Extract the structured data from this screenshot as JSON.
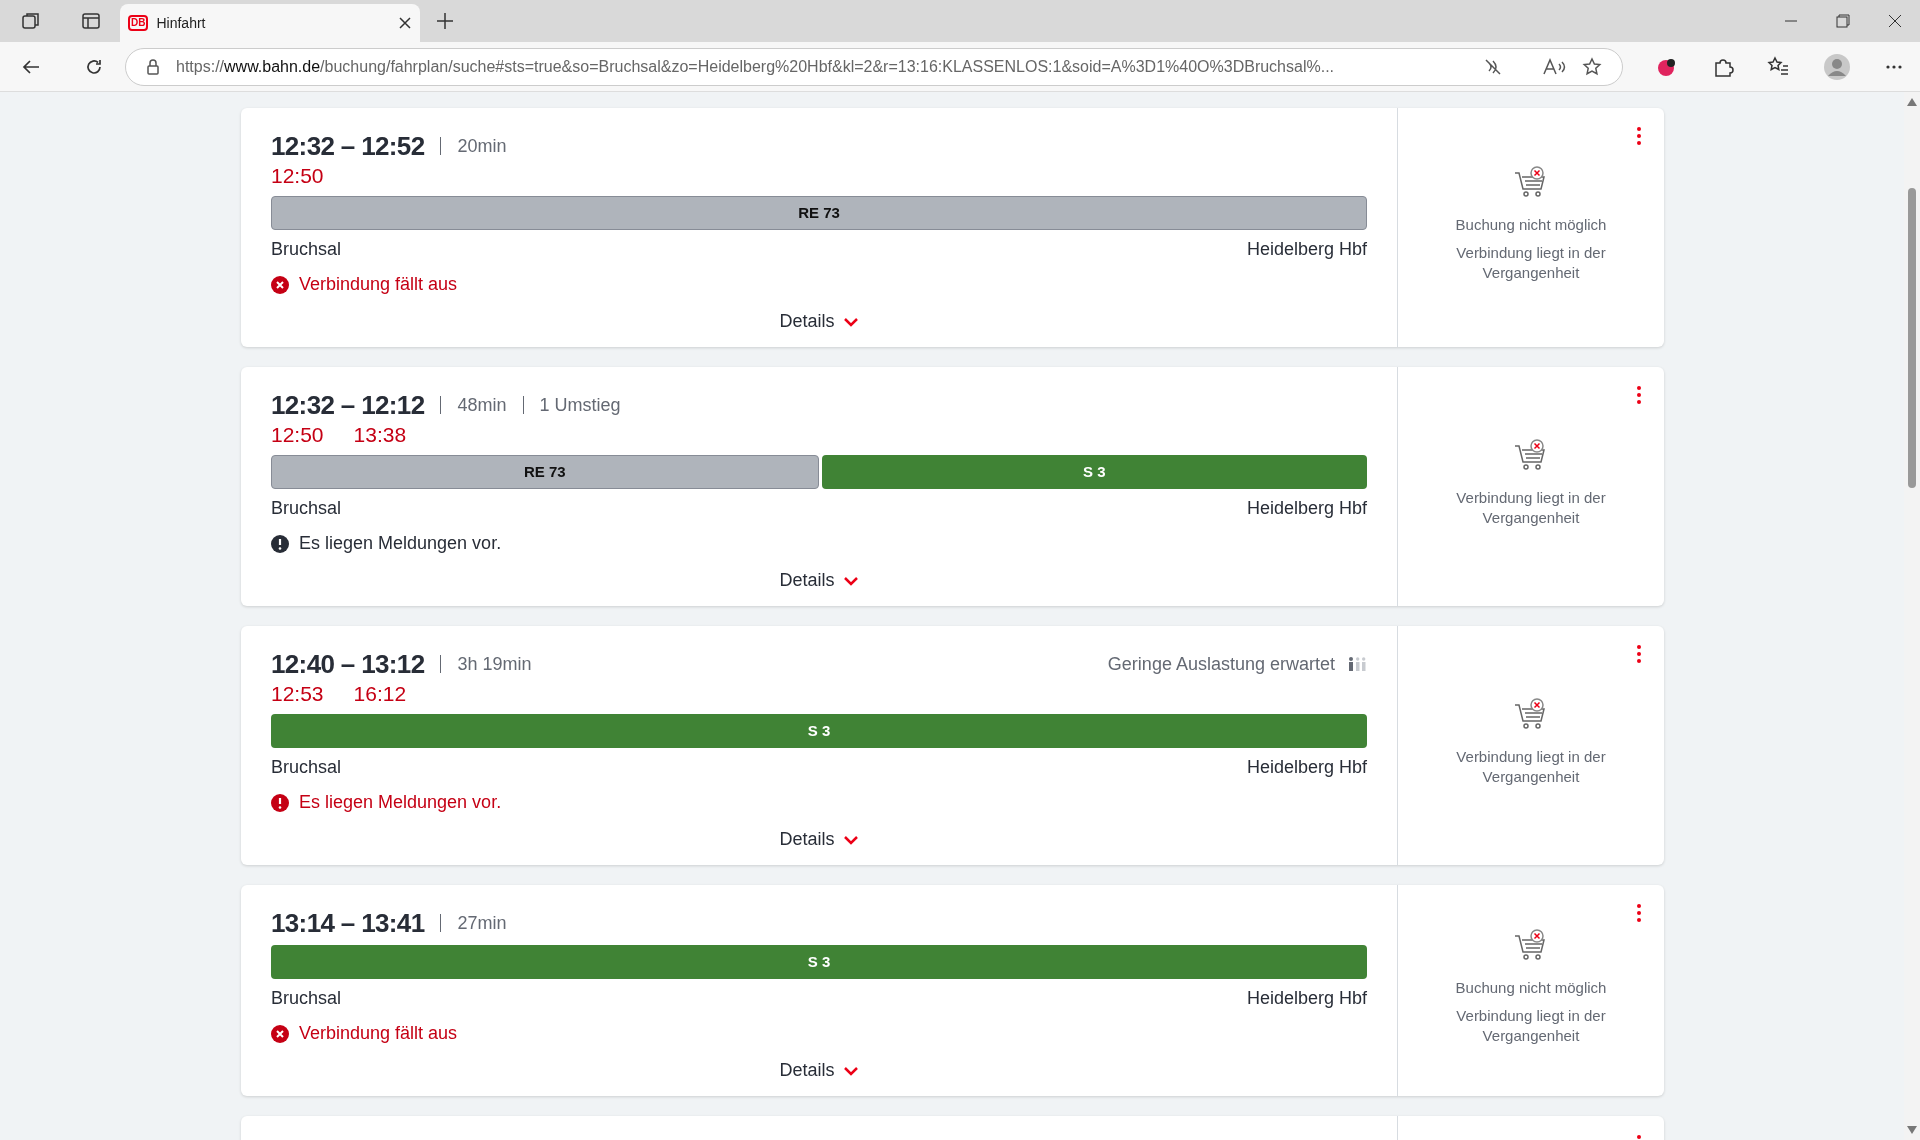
{
  "browser": {
    "tab_title": "Hinfahrt",
    "tab_logo": "DB",
    "url_prefix": "https://",
    "url_host": "www.bahn.de",
    "url_rest": "/buchung/fahrplan/suche#sts=true&so=Bruchsal&zo=Heidelberg%20Hbf&kl=2&r=13:16:KLASSENLOS:1&soid=A%3D1%40O%3DBruchsal%..."
  },
  "connections": [
    {
      "times": "12:32 – 12:52",
      "duration": "20min",
      "delays": [
        "12:50"
      ],
      "segments": [
        {
          "label": "RE 73",
          "kind": "regional"
        }
      ],
      "from": "Bruchsal",
      "to": "Heidelberg Hbf",
      "message": {
        "kind": "cancelled",
        "text": "Verbindung fällt aus"
      },
      "details": "Details",
      "booking": [
        "Buchung nicht möglich",
        "Verbindung liegt in der Vergangenheit"
      ]
    },
    {
      "times": "12:32 – 12:12",
      "duration": "48min",
      "transfers": "1 Umstieg",
      "delays": [
        "12:50",
        "13:38"
      ],
      "segments": [
        {
          "label": "RE 73",
          "kind": "regional"
        },
        {
          "label": "S 3",
          "kind": "sbahn"
        }
      ],
      "from": "Bruchsal",
      "to": "Heidelberg Hbf",
      "message": {
        "kind": "info",
        "text": "Es liegen Meldungen vor."
      },
      "details": "Details",
      "booking": [
        "Verbindung liegt in der Vergangenheit"
      ]
    },
    {
      "times": "12:40 – 13:12",
      "duration": "3h 19min",
      "occupancy": "Geringe Auslastung erwartet",
      "delays": [
        "12:53",
        "16:12"
      ],
      "segments": [
        {
          "label": "S 3",
          "kind": "sbahn"
        }
      ],
      "from": "Bruchsal",
      "to": "Heidelberg Hbf",
      "message": {
        "kind": "warning",
        "text": "Es liegen Meldungen vor."
      },
      "details": "Details",
      "booking": [
        "Verbindung liegt in der Vergangenheit"
      ]
    },
    {
      "times": "13:14 – 13:41",
      "duration": "27min",
      "segments": [
        {
          "label": "S 3",
          "kind": "sbahn"
        }
      ],
      "from": "Bruchsal",
      "to": "Heidelberg Hbf",
      "message": {
        "kind": "cancelled",
        "text": "Verbindung fällt aus"
      },
      "details": "Details",
      "booking": [
        "Buchung nicht möglich",
        "Verbindung liegt in der Vergangenheit"
      ]
    }
  ]
}
